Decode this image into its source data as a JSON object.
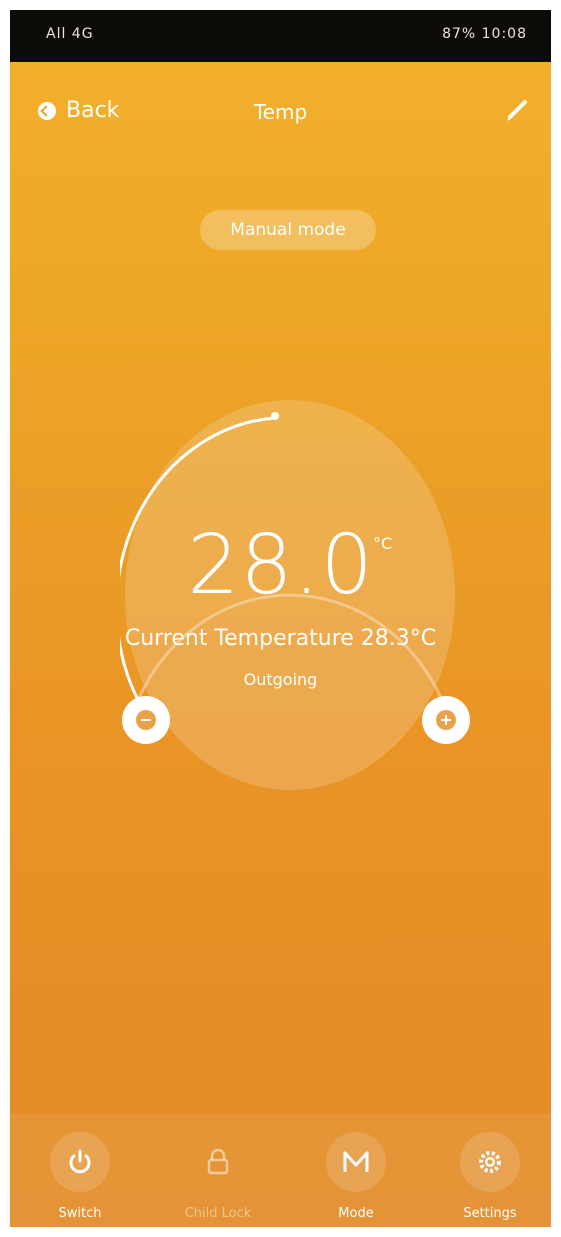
{
  "status_bar": {
    "left_text": "All 4G",
    "right_text": "87% 10:08"
  },
  "header": {
    "back_label": "Back",
    "title": "Temp"
  },
  "mode_label": "Manual mode",
  "thermostat": {
    "set_temperature": "28.0",
    "unit": "°C",
    "current_temperature_text": "Current Temperature 28.3°C",
    "status_text": "Outgoing"
  },
  "bottom_nav": [
    {
      "label": "Switch",
      "icon": "power-icon",
      "enabled": true
    },
    {
      "label": "Child Lock",
      "icon": "lock-icon",
      "enabled": false
    },
    {
      "label": "Mode",
      "icon": "mode-m-icon",
      "enabled": true
    },
    {
      "label": "Settings",
      "icon": "gear-icon",
      "enabled": true
    }
  ],
  "colors": {
    "accent": "#eca327",
    "white": "#ffffff"
  }
}
